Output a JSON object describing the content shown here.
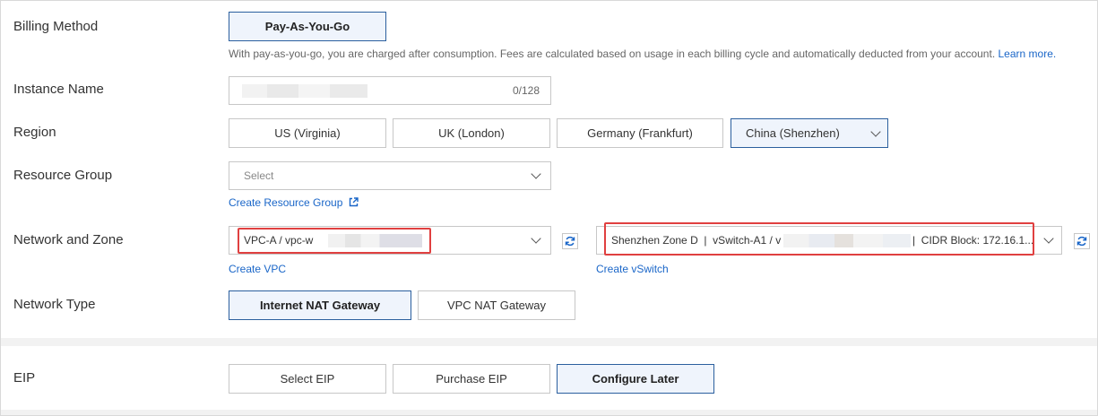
{
  "billing": {
    "label": "Billing Method",
    "option": "Pay-As-You-Go",
    "description": "With pay-as-you-go, you are charged after consumption. Fees are calculated based on usage in each billing cycle and automatically deducted from your account.",
    "learn_more": "Learn more."
  },
  "instance": {
    "label": "Instance Name",
    "counter": "0/128"
  },
  "region": {
    "label": "Region",
    "options": [
      "US (Virginia)",
      "UK (London)",
      "Germany (Frankfurt)",
      "China (Shenzhen)"
    ]
  },
  "resource_group": {
    "label": "Resource Group",
    "placeholder": "Select",
    "create_link": "Create Resource Group"
  },
  "network": {
    "label": "Network and Zone",
    "vpc_value": "VPC-A / vpc-w",
    "create_vpc": "Create VPC",
    "vswitch_prefix": "Shenzhen Zone D  |  vSwitch-A1 / v",
    "vswitch_suffix": "|  CIDR Block: 172.16.1...",
    "create_vswitch": "Create vSwitch"
  },
  "network_type": {
    "label": "Network Type",
    "options": [
      "Internet NAT Gateway",
      "VPC NAT Gateway"
    ]
  },
  "eip": {
    "label": "EIP",
    "options": [
      "Select EIP",
      "Purchase EIP",
      "Configure Later"
    ]
  },
  "colors": {
    "accent": "#2b5f9e",
    "selected_bg": "#eff4fc",
    "link": "#1a66c8",
    "highlight": "#e04040"
  }
}
